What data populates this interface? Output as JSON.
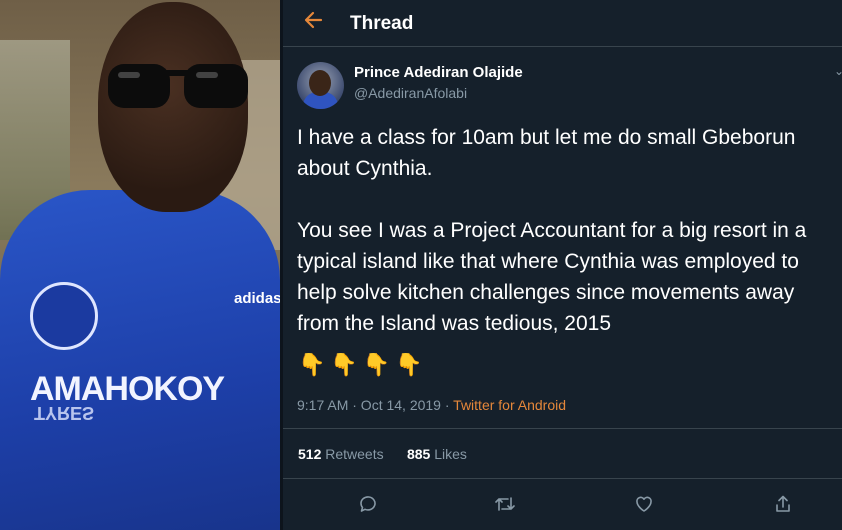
{
  "header": {
    "title": "Thread"
  },
  "tweet": {
    "author_name": "Prince Adediran Olajide",
    "author_handle": "@AdediranAfolabi",
    "text": "I have a class for 10am but let me do small Gbeborun\nabout Cynthia.\n\nYou see I was a Project Accountant for a big resort in a\ntypical island like that where Cynthia was employed to\nhelp solve kitchen challenges since movements away\nfrom the Island was tedious, 2015",
    "emoji": "👇👇👇👇",
    "timestamp": "9:17 AM · Oct 14, 2019 · ",
    "source": "Twitter for Android",
    "retweets_count": "512",
    "retweets_label": "Retweets",
    "likes_count": "885",
    "likes_label": "Likes"
  },
  "photo": {
    "shirt_sponsor": "AMAHOKOY",
    "shirt_sponsor_mirror": "TYRES",
    "brand": "adidas"
  },
  "colors": {
    "accent": "#e5873a",
    "background": "#15202b",
    "muted": "#8899a6"
  },
  "icons": [
    "back-arrow-icon",
    "reply-icon",
    "retweet-icon",
    "like-icon",
    "share-icon"
  ]
}
